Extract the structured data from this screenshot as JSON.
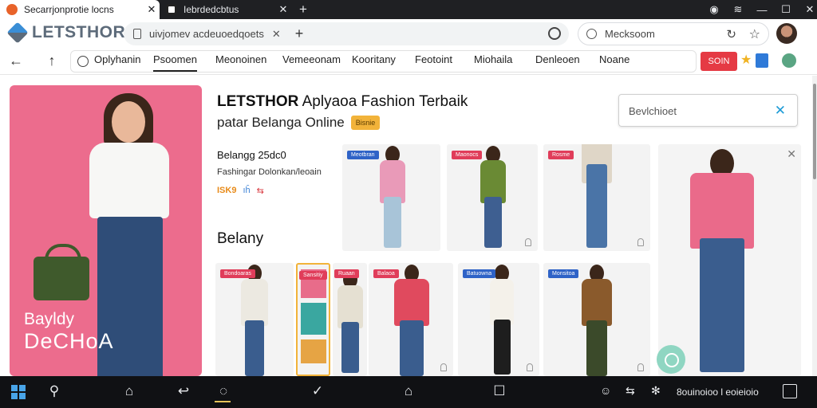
{
  "browser": {
    "tabs": [
      {
        "title": "Secarrjonprotie locns",
        "active": true
      },
      {
        "title": "Iebrdedcbtus",
        "active": false
      }
    ],
    "window_controls": [
      "—",
      "☐",
      "✕"
    ],
    "address": "uivjomev acdeuoedqoets",
    "secondary_search": "Mecksoom",
    "nav_items": [
      "Oplyhanin",
      "Psoomen",
      "Meonoinen",
      "Vemeeonam",
      "Kooritany",
      "Feotoint",
      "Miohaila",
      "Denleoen",
      "Noane"
    ],
    "active_nav": 1,
    "promo_button": "SOIN"
  },
  "site": {
    "logo_text": "LETSTHOR",
    "headline_brand": "LETSTHOR",
    "headline_rest": " Aplyaoa Fashion Terbaik",
    "subheadline": "patar Belanga Online",
    "subheadline_tag": "Bisnie",
    "search_placeholder": "Bevlchioet",
    "hero": {
      "caption_line1": "Bayldy",
      "caption_line2": "DeCHoA"
    },
    "side": {
      "title": "Belangg 25dc0",
      "subtitle": "Fashingar Dolonkan/leoain",
      "icons_text": [
        "ISK9",
        "ıĥ",
        "⇆"
      ],
      "heading": "Belany"
    },
    "product_badges": [
      {
        "label": "Meotbran",
        "color": "#2f63c7"
      },
      {
        "label": "Maonocs",
        "color": "#e03d5a"
      },
      {
        "label": "Rosme",
        "color": "#e03d5a"
      },
      {
        "label": "Bondoaras",
        "color": "#e03d5a"
      },
      {
        "label": "Sansitiy",
        "color": "#e03d5a"
      },
      {
        "label": "Ruaan",
        "color": "#e03d5a"
      },
      {
        "label": "Balaoa",
        "color": "#e03d5a"
      },
      {
        "label": "Batuowna",
        "color": "#2f63c7"
      },
      {
        "label": "Monsitoa",
        "color": "#2f63c7"
      }
    ]
  },
  "taskbar": {
    "status_text": "8ouinoioo l eoieioio",
    "icons": [
      "windows-icon",
      "search-icon",
      "home-icon",
      "back-icon",
      "camera-icon",
      "check-icon",
      "home-icon",
      "square-icon"
    ]
  },
  "colors": {
    "accent": "#ec6c8d",
    "promo": "#e53a44",
    "tag": "#f2b33a",
    "link": "#1d9bd6"
  }
}
